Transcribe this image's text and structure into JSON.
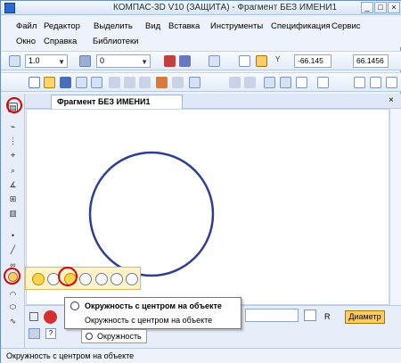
{
  "window": {
    "title": "КОМПАС-3D V10 (ЗАЩИТА) - Фрагмент БЕЗ ИМЕНИ1",
    "min_label": "_",
    "max_label": "□",
    "close_label": "×"
  },
  "menu": {
    "row1": [
      "Файл",
      "Редактор",
      "Выделить",
      "Вид",
      "Вставка",
      "Инструменты",
      "Спецификация",
      "Сервис"
    ],
    "row2": [
      "Окно",
      "Справка",
      "Библиотеки"
    ]
  },
  "toolbar1": {
    "scale_value": "1.0",
    "layer_value": "0",
    "coord_x_label": "Y",
    "coord_x": "-66.145",
    "coord_y": "66.1456"
  },
  "tabs": {
    "document_tab": "Фрагмент БЕЗ ИМЕНИ1"
  },
  "tooltip": {
    "title": "Окружность с центром на объекте",
    "description": "Окружность с центром на объекте"
  },
  "properties": {
    "r_label": "R",
    "diameter_button": "Диаметр",
    "bottom_label": "Окружность"
  },
  "status": {
    "text": "Окружность с центром на объекте"
  },
  "colors": {
    "title_bg": "#dfe9f7",
    "circle_stroke": "#2d3f8f",
    "highlight_red": "#e00000",
    "active_tool": "#ffd34d"
  },
  "icons": {
    "main_menu_icon": "app-icon",
    "circle_icon": "circle-icon",
    "close_tab": "close-icon"
  }
}
